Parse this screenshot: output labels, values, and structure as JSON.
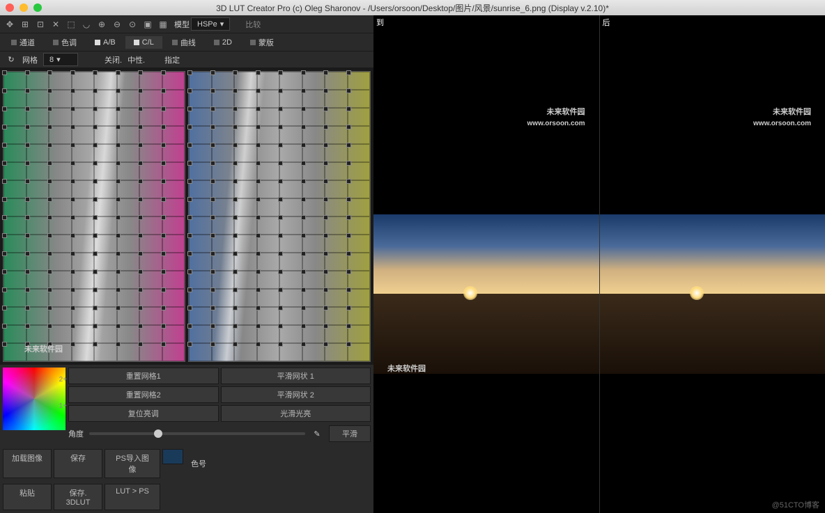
{
  "title": "3D LUT Creator Pro (c) Oleg Sharonov - /Users/orsoon/Desktop/图片/风景/sunrise_6.png (Display v.2.10)*",
  "toolbar": {
    "model": "模型",
    "hspe": "HSPe",
    "compare": "比较"
  },
  "tabs": {
    "channel": "通道",
    "tone": "色调",
    "ab": "A/B",
    "cl": "C/L",
    "curve": "曲线",
    "d2": "2D",
    "mask": "蒙版"
  },
  "optbar": {
    "grid": "网格",
    "gridval": "8",
    "closed": "关闭.",
    "neutral": "中性.",
    "lock": "指定"
  },
  "colorlabels": {
    "l2": "2+",
    "l1": "1+"
  },
  "buttons": {
    "reset1": "重置网格1",
    "smooth1": "平滑网状 1",
    "reset2": "重置网格2",
    "smooth2": "平滑网状 2",
    "resettone": "复位亮调",
    "smoothlight": "光滑光亮",
    "angle": "角度",
    "smooth": "平滑"
  },
  "bottom": {
    "load": "加载图像",
    "save": "保存",
    "psimport": "PS导入图像",
    "paste": "粘贴",
    "save3d": "保存. 3DLUT",
    "luttops": "LUT > PS",
    "colornum": "色号"
  },
  "preview": {
    "to": "到",
    "after": "后"
  },
  "watermark": "未来软件园",
  "watermark_url": "www.orsoon.com",
  "credit": "@51CTO博客"
}
